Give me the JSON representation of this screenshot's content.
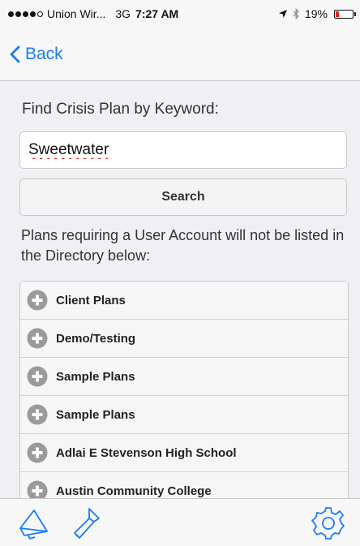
{
  "status_bar": {
    "carrier": "Union Wir...",
    "network": "3G",
    "time": "7:27 AM",
    "battery": "19%",
    "battery_level": 0.19
  },
  "nav": {
    "back_label": "Back"
  },
  "search": {
    "label": "Find Crisis Plan by Keyword:",
    "value": "Sweetwater",
    "button_label": "Search"
  },
  "note": "Plans requiring a User Account will not be listed in the Directory below:",
  "plans": [
    {
      "label": "Client Plans"
    },
    {
      "label": "Demo/Testing"
    },
    {
      "label": "Sample Plans"
    },
    {
      "label": "Sample Plans"
    },
    {
      "label": "Adlai E Stevenson High School"
    },
    {
      "label": "Austin Community College"
    }
  ],
  "tab_bar": {
    "icons": [
      "megaphone-icon",
      "flashlight-icon",
      "gear-icon"
    ]
  },
  "colors": {
    "accent": "#1a7cf5",
    "battery_low": "#e0241d",
    "plus_icon": "#9a9a9a"
  }
}
